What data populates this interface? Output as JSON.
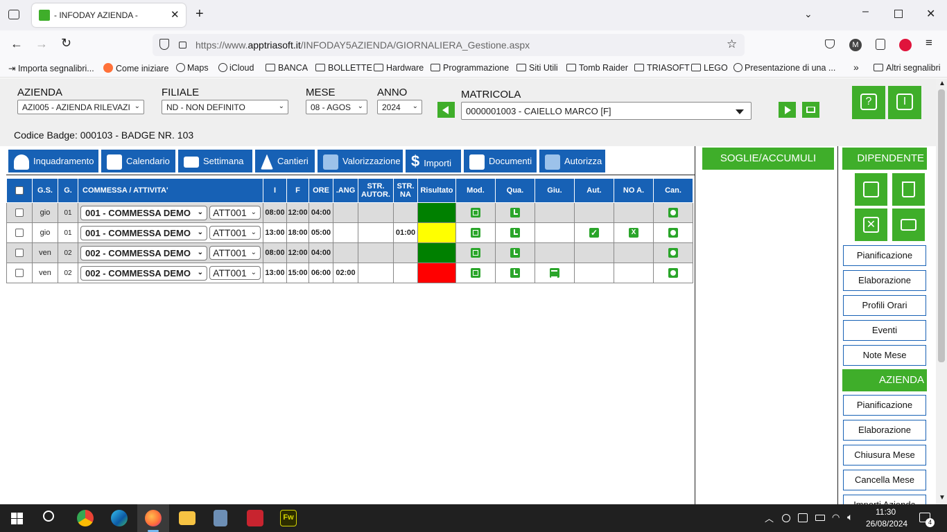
{
  "browser": {
    "tab_title": "- INFODAY AZIENDA -",
    "url_prefix": "https://www.",
    "url_host": "apptriasoft.it",
    "url_path": "/INFODAY5AZIENDA/GIORNALIERA_Gestione.aspx",
    "bookmarks": [
      "Importa segnalibri...",
      "Come iniziare",
      "Maps",
      "iCloud",
      "BANCA",
      "BOLLETTE",
      "Hardware",
      "Programmazione",
      "Siti Utili",
      "Tomb Raider",
      "TRIASOFT",
      "LEGO",
      "Presentazione di una ..."
    ],
    "other_bookmarks": "Altri segnalibri",
    "profile_letter": "M"
  },
  "header": {
    "azienda_label": "AZIENDA",
    "azienda_value": "AZI005 - AZIENDA RILEVAZI",
    "filiale_label": "FILIALE",
    "filiale_value": "ND - NON DEFINITO",
    "mese_label": "MESE",
    "mese_value": "08 - AGOS",
    "anno_label": "ANNO",
    "anno_value": "2024",
    "matricola_label": "MATRICOLA",
    "matricola_value": "0000001003 - CAIELLO MARCO [F]",
    "badge": "Codice Badge: 000103 - BADGE NR. 103",
    "help_label": "?",
    "info_label": "I"
  },
  "tabs": [
    "Inquadramento",
    "Calendario",
    "Settimana",
    "Cantieri",
    "Valorizzazione",
    "Importi",
    "Documenti",
    "Autorizza"
  ],
  "grid": {
    "headers": [
      "G.S.",
      "G.",
      "COMMESSA / ATTIVITA'",
      "I",
      "F",
      "ORE",
      ".ANG",
      "STR. AUTOR.",
      "STR. NA",
      "Risultato",
      "Mod.",
      "Qua.",
      "Giu.",
      "Aut.",
      "NO A.",
      "Can."
    ],
    "rows": [
      {
        "gs": "gio",
        "g": "01",
        "commessa": "001 - COMMESSA DEMO",
        "att": "ATT001",
        "i": "08:00",
        "f": "12:00",
        "ore": "04:00",
        "ang": "",
        "str_aut": "",
        "str_na": "",
        "risultato_color": "#008000",
        "giu": false,
        "aut": false,
        "noa": false
      },
      {
        "gs": "gio",
        "g": "01",
        "commessa": "001 - COMMESSA DEMO",
        "att": "ATT001",
        "i": "13:00",
        "f": "18:00",
        "ore": "05:00",
        "ang": "",
        "str_aut": "",
        "str_na": "01:00",
        "risultato_color": "#ffff00",
        "giu": false,
        "aut": true,
        "noa": true
      },
      {
        "gs": "ven",
        "g": "02",
        "commessa": "002 - COMMESSA DEMO",
        "att": "ATT001",
        "i": "08:00",
        "f": "12:00",
        "ore": "04:00",
        "ang": "",
        "str_aut": "",
        "str_na": "",
        "risultato_color": "#008000",
        "giu": false,
        "aut": false,
        "noa": false
      },
      {
        "gs": "ven",
        "g": "02",
        "commessa": "002 - COMMESSA DEMO",
        "att": "ATT001",
        "i": "13:00",
        "f": "15:00",
        "ore": "06:00",
        "ang": "02:00",
        "str_aut": "",
        "str_na": "",
        "risultato_color": "#ff0000",
        "giu": true,
        "aut": false,
        "noa": false
      }
    ]
  },
  "soglie": {
    "title": "SOGLIE/ACCUMULI"
  },
  "dipendente": {
    "title": "DIPENDENTE",
    "buttons": [
      "Pianificazione",
      "Elaborazione",
      "Profili Orari",
      "Eventi",
      "Note Mese"
    ]
  },
  "azienda_panel": {
    "title": "AZIENDA",
    "buttons": [
      "Pianificazione",
      "Elaborazione",
      "Chiusura Mese",
      "Cancella Mese",
      "Importi Azienda"
    ]
  },
  "taskbar": {
    "time": "11:30",
    "date": "26/08/2024",
    "notifications": "4"
  },
  "colors": {
    "blue": "#1761b5",
    "green": "#3fae2a"
  }
}
